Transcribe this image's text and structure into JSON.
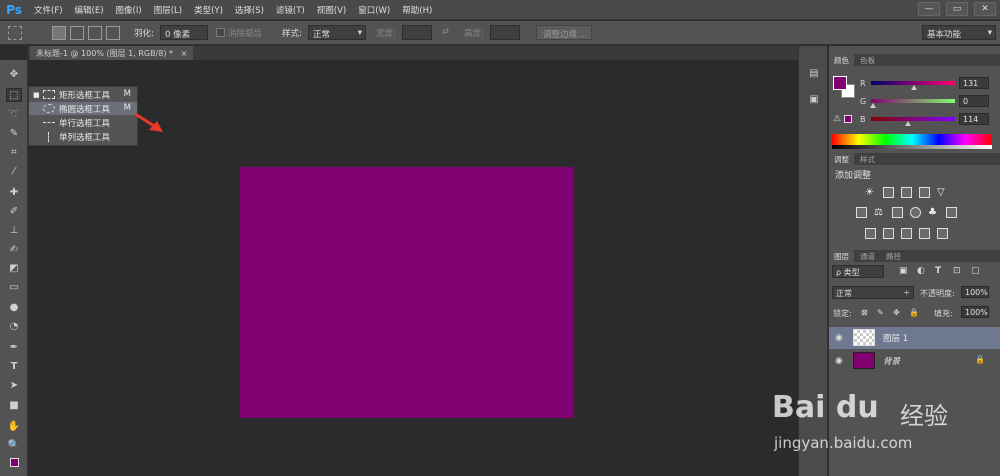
{
  "app": {
    "logo": "Ps"
  },
  "menu": [
    "文件(F)",
    "编辑(E)",
    "图像(I)",
    "图层(L)",
    "类型(Y)",
    "选择(S)",
    "滤镜(T)",
    "视图(V)",
    "窗口(W)",
    "帮助(H)"
  ],
  "window_controls": [
    "—",
    "▭",
    "✕"
  ],
  "options": {
    "feather_label": "羽化:",
    "feather_value": "0 像素",
    "antialias_label": "消除锯齿",
    "style_label": "样式:",
    "style_value": "正常",
    "width_label": "宽度:",
    "height_label": "高度:",
    "refine_edge": "调整边缘...",
    "workspace": "基本功能"
  },
  "document_tab": {
    "title": "未标题-1 @ 100% (图层 1, RGB/8) *",
    "close": "×"
  },
  "flyout": [
    {
      "label": "矩形选框工具",
      "key": "M",
      "selected": true
    },
    {
      "label": "椭圆选框工具",
      "key": "M",
      "highlighted": true
    },
    {
      "label": "单行选框工具",
      "key": ""
    },
    {
      "label": "单列选框工具",
      "key": ""
    }
  ],
  "canvas": {
    "fill_color": "#800072"
  },
  "color_panel": {
    "tabs": [
      "颜色",
      "色板"
    ],
    "r_label": "R",
    "g_label": "G",
    "b_label": "B",
    "r_value": "131",
    "g_value": "0",
    "b_value": "114",
    "foreground": "#830072"
  },
  "adjust_panel": {
    "tabs": [
      "调整",
      "样式"
    ],
    "title": "添加调整"
  },
  "layers_panel": {
    "tabs": [
      "图层",
      "通道",
      "路径"
    ],
    "filter_kind": "ρ 类型",
    "blend_mode": "正常",
    "opacity_label": "不透明度:",
    "opacity_value": "100%",
    "lock_label": "锁定:",
    "fill_label": "填充:",
    "fill_value": "100%",
    "layers": [
      {
        "name": "图层 1",
        "selected": true
      },
      {
        "name": "背景",
        "selected": false
      }
    ]
  },
  "watermark": {
    "logo": "Bai du",
    "cn": "经验",
    "url": "jingyan.baidu.com"
  }
}
